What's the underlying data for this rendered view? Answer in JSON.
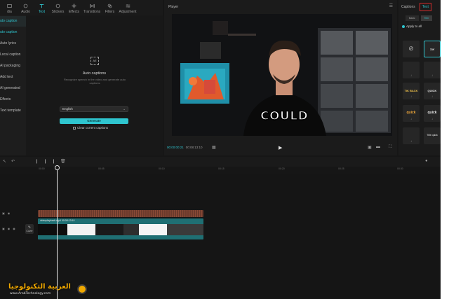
{
  "toolbar": {
    "items": [
      {
        "label": "dia",
        "icon": "media-icon"
      },
      {
        "label": "Audio",
        "icon": "audio-icon"
      },
      {
        "label": "Text",
        "icon": "text-icon",
        "active": true
      },
      {
        "label": "Stickers",
        "icon": "sticker-icon"
      },
      {
        "label": "Effects",
        "icon": "effects-icon"
      },
      {
        "label": "Transitions",
        "icon": "transitions-icon"
      },
      {
        "label": "Filters",
        "icon": "filters-icon"
      },
      {
        "label": "Adjustment",
        "icon": "adjustment-icon"
      }
    ]
  },
  "categories": [
    "uto caption",
    "uto caption",
    "Auto lyrics",
    "Local caption",
    "AI packaging",
    "Add text",
    "AI generated",
    "Effects",
    "Text template"
  ],
  "captions_panel": {
    "icon_text": "AE",
    "title": "Auto captions",
    "description": "Recognize speech in the video and generate auto captions",
    "language": "English",
    "generate_label": "Generate",
    "clear_label": "Clear current captions"
  },
  "player": {
    "title": "Player",
    "caption_word": "COULD",
    "current_time": "00:00:00:21",
    "total_time": "00:08:13:10"
  },
  "right_panel": {
    "tab_captions": "Captions",
    "tab_text": "Text",
    "sub_tabs": [
      "Basic",
      "Tem"
    ],
    "apply_all": "Apply to all",
    "tiles": [
      "",
      "TIK",
      "",
      "",
      "TIK BACK",
      "QUICK",
      "quick",
      "quick",
      "",
      "Title quick"
    ]
  },
  "timeline": {
    "ruler_ticks": [
      "00:00",
      "00:05",
      "00:10",
      "00:15",
      "00:20",
      "00:25",
      "00:30"
    ],
    "clip_label": "videoplayback.mp4  00:08:13:10",
    "cover_label": "Cover"
  },
  "watermark": {
    "main": "العربية التكنولوجيا",
    "sub": "www.ArabTechnology.com"
  },
  "colors": {
    "accent": "#2fc5cf",
    "highlight_box": "#d12b2b",
    "clip": "#1f6f73",
    "audio": "#8a4a36"
  }
}
